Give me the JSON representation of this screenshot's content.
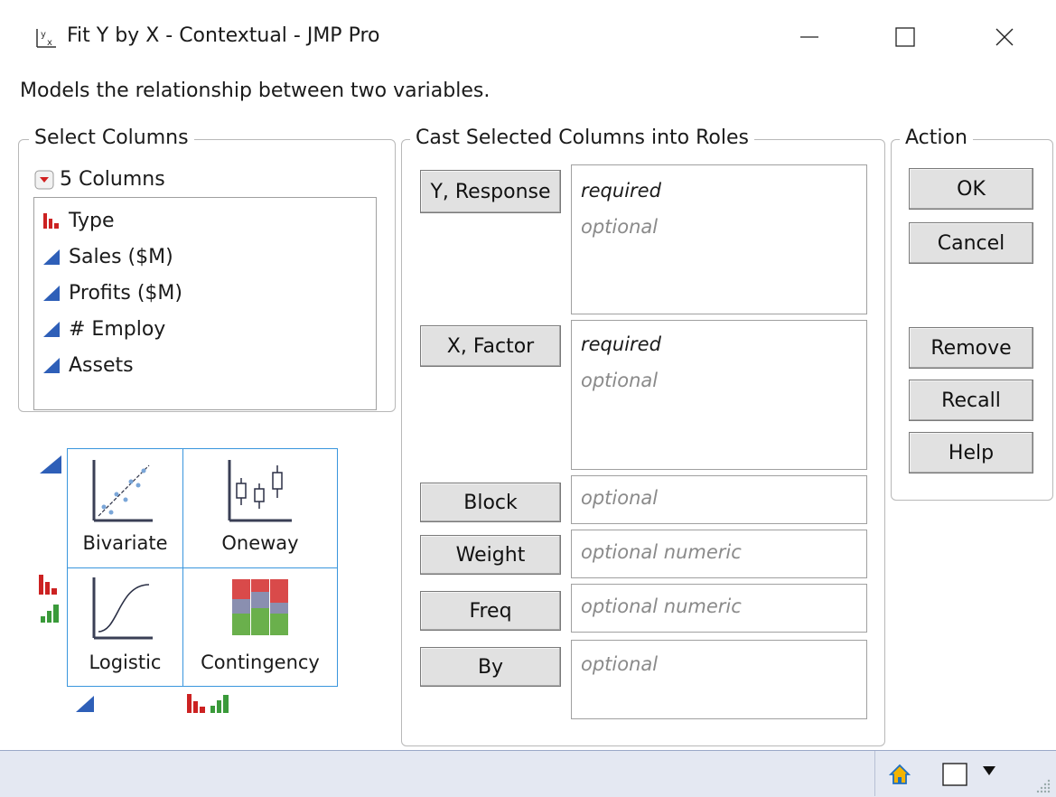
{
  "window": {
    "title": "Fit Y by X - Contextual - JMP Pro",
    "title_icon": "fit-y-by-x-icon",
    "controls": [
      "minimize",
      "maximize",
      "close"
    ]
  },
  "description": "Models the relationship between two variables.",
  "select_columns": {
    "legend": "Select Columns",
    "count_label": "5 Columns",
    "columns": [
      {
        "name": "Type",
        "icon": "nominal-bar-icon",
        "color": "#cc2222"
      },
      {
        "name": "Sales ($M)",
        "icon": "continuous-triangle-icon",
        "color": "#2e5fb8"
      },
      {
        "name": "Profits ($M)",
        "icon": "continuous-triangle-icon",
        "color": "#2e5fb8"
      },
      {
        "name": "# Employ",
        "icon": "continuous-triangle-icon",
        "color": "#2e5fb8"
      },
      {
        "name": "Assets",
        "icon": "continuous-triangle-icon",
        "color": "#2e5fb8"
      }
    ]
  },
  "platforms": {
    "cells": [
      {
        "label": "Bivariate",
        "icon": "bivariate-scatter-icon"
      },
      {
        "label": "Oneway",
        "icon": "oneway-boxplot-icon"
      },
      {
        "label": "Logistic",
        "icon": "logistic-curve-icon"
      },
      {
        "label": "Contingency",
        "icon": "contingency-mosaic-icon"
      }
    ]
  },
  "roles": {
    "legend": "Cast Selected Columns into Roles",
    "items": [
      {
        "button": "Y, Response",
        "required": "required",
        "optional": "optional"
      },
      {
        "button": "X, Factor",
        "required": "required",
        "optional": "optional"
      },
      {
        "button": "Block",
        "optional": "optional"
      },
      {
        "button": "Weight",
        "optional": "optional numeric"
      },
      {
        "button": "Freq",
        "optional": "optional numeric"
      },
      {
        "button": "By",
        "optional": "optional"
      }
    ]
  },
  "action": {
    "legend": "Action",
    "buttons": [
      "OK",
      "Cancel",
      "Remove",
      "Recall",
      "Help"
    ]
  },
  "colors": {
    "continuous": "#2e5fb8",
    "nominal": "#cc2222",
    "ordinal": "#3a9a3a",
    "grid_border": "#3a96dd",
    "status_bar": "#e4e8f2"
  }
}
